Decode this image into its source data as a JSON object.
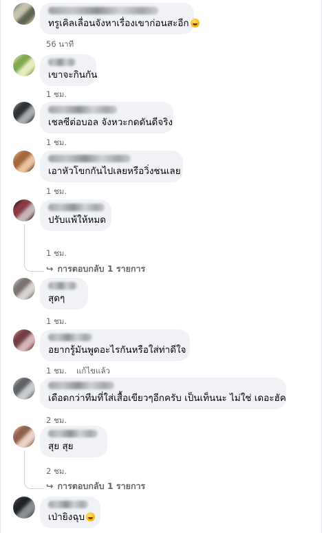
{
  "comments": [
    {
      "text": "ทรูเคิลเลื่อนจังหาเรื่องเขาก่อนสะอีก",
      "emoji": true,
      "time": "56 นาที",
      "edited": "",
      "replies": "",
      "avatar_colors": [
        "#8a8f7c",
        "#c9c2b0",
        "#5d6652",
        "#b5ad99"
      ],
      "name_width": 160
    },
    {
      "text": "เขาจะกินกัน",
      "emoji": false,
      "time": "1 ชม.",
      "edited": "",
      "replies": "",
      "avatar_colors": [
        "#c7d18b",
        "#7fa852",
        "#e7edc1",
        "#9bb26a"
      ],
      "name_width": 40
    },
    {
      "text": "เชลซีต่อบอล จังหวะกดดันดีจริง",
      "emoji": false,
      "time": "1 ชม.",
      "edited": "",
      "replies": "",
      "avatar_colors": [
        "#6b6e73",
        "#2d3035",
        "#a9abae",
        "#4c4f54"
      ],
      "name_width": 100
    },
    {
      "text": "เอาหัวโขกกันไปเลยหรือวิ่งชนเลย",
      "emoji": false,
      "time": "1 ชม.",
      "edited": "",
      "replies": "",
      "avatar_colors": [
        "#d29a6e",
        "#a4683e",
        "#e8c3a0",
        "#8c5a36"
      ],
      "name_width": 120
    },
    {
      "text": "ปรับแพ้ให้หมด",
      "emoji": false,
      "time": "1 ชม.",
      "edited": "",
      "replies": "1 การตอบกลับ 1 รายการ",
      "reply_text": "การตอบกลับ 1 รายการ",
      "avatar_colors": [
        "#3a2a2e",
        "#8a3944",
        "#c5b7ba",
        "#5e4a4f"
      ],
      "name_width": 82
    },
    {
      "text": "สุดๆ",
      "emoji": false,
      "time": "1 ชม.",
      "edited": "",
      "replies": "",
      "avatar_colors": [
        "#b1aaa6",
        "#7b736f",
        "#d8d3cf",
        "#968f8b"
      ],
      "name_width": 42
    },
    {
      "text": "อยากรู้มันพูดอะไรกันหรือใส่ท่าดีใจ",
      "emoji": false,
      "time": "1 ชม.",
      "edited": "แก้ไขแล้ว",
      "replies": "",
      "avatar_colors": [
        "#a86a6e",
        "#6f3f43",
        "#d7b6b8",
        "#8a5458"
      ],
      "name_width": 64
    },
    {
      "text": "เดือดกว่าทีมที่ใส่เสื้อเขียวๆอีกครับ เป็นเท็นนะ ไม่ใช่ เดอะฮัค",
      "emoji": false,
      "time": "2 ชม.",
      "edited": "",
      "replies": "",
      "avatar_colors": [
        "#9a9c9f",
        "#5f6266",
        "#c9cbcd",
        "#7b7e82"
      ],
      "name_width": 96
    },
    {
      "text": "สุย สุย",
      "emoji": false,
      "time": "2 ชม.",
      "edited": "",
      "replies": "1 การตอบกลับ 1 รายการ",
      "reply_text": "การตอบกลับ 1 รายการ",
      "avatar_colors": [
        "#c99b86",
        "#8e5f4d",
        "#ead2c6",
        "#a97a67"
      ],
      "name_width": 72
    },
    {
      "text": "เป่ายิงฉุบ",
      "emoji": true,
      "time": "",
      "edited": "",
      "replies": "",
      "avatar_colors": [
        "#3c3f45",
        "#1f2226",
        "#8a8d92",
        "#55585e"
      ],
      "name_width": 58
    }
  ],
  "icons": {
    "reply_arrow": "reply-arrow-icon",
    "emoji": "grinning-sweat-emoji-icon"
  },
  "colors": {
    "bubble": "#f0f2f5",
    "meta": "#65676b",
    "text": "#050505"
  }
}
